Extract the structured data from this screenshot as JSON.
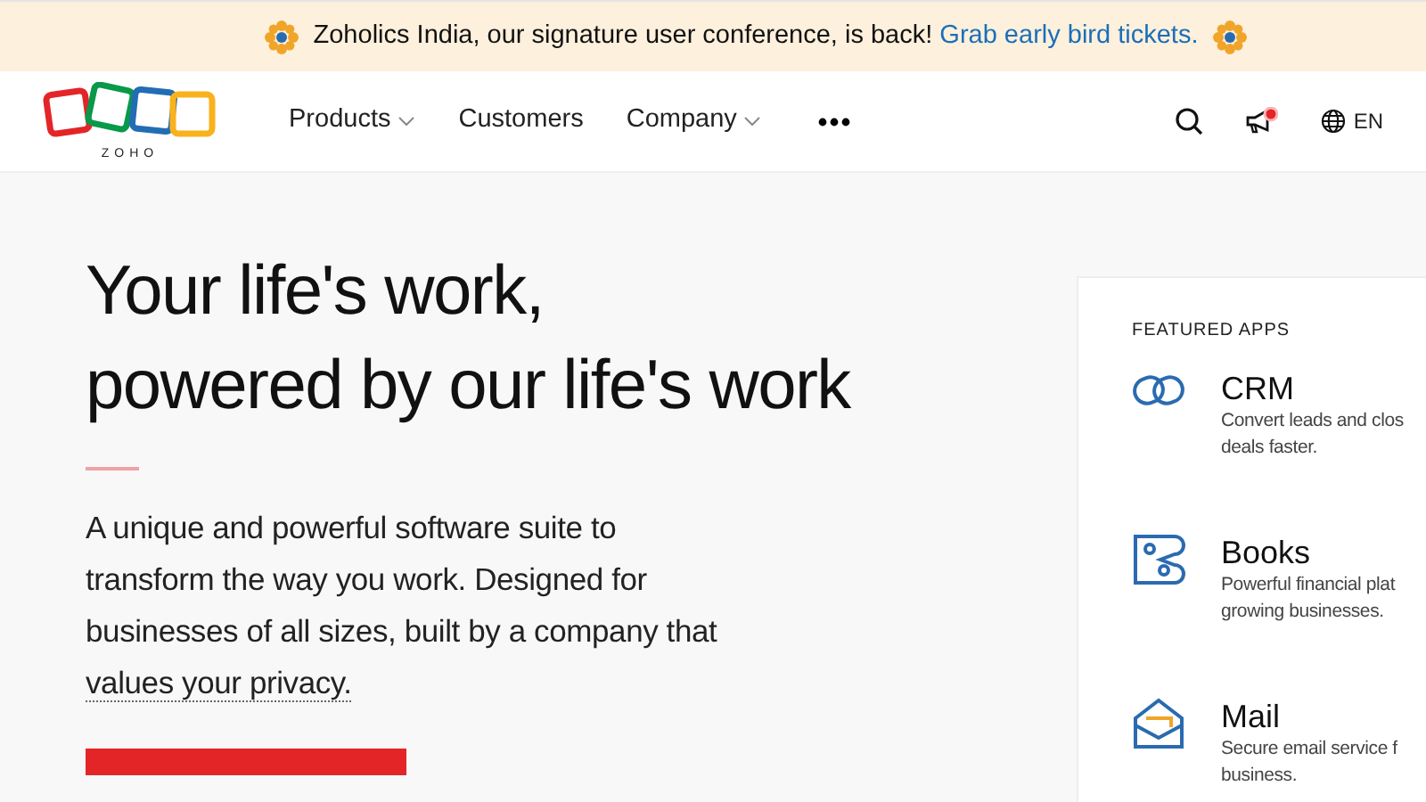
{
  "banner": {
    "text": "Zoholics India, our signature user conference, is back!",
    "link": "Grab early bird tickets."
  },
  "logo": {
    "text": "ZOHO"
  },
  "nav": [
    {
      "label": "Products",
      "dropdown": true
    },
    {
      "label": "Customers",
      "dropdown": false
    },
    {
      "label": "Company",
      "dropdown": true
    }
  ],
  "nav_tools": {
    "notification": true,
    "language": "EN"
  },
  "hero": {
    "title_lines": [
      "Your life's work,",
      "powered by our life's work"
    ],
    "text_lines": [
      "A unique and powerful software suite to",
      "transform the way you work. Designed for",
      "businesses of all sizes, built by a company that"
    ],
    "link": "values your privacy."
  },
  "featured": {
    "heading": "FEATURED APPS",
    "apps": [
      {
        "kind": "crm",
        "name": "CRM",
        "desc_lines": [
          "Convert leads and clos",
          "deals faster."
        ]
      },
      {
        "kind": "books",
        "name": "Books",
        "desc_lines": [
          "Powerful financial plat",
          "growing businesses."
        ]
      },
      {
        "kind": "mail",
        "name": "Mail",
        "desc_lines": [
          "Secure email service f",
          "business."
        ]
      }
    ]
  }
}
